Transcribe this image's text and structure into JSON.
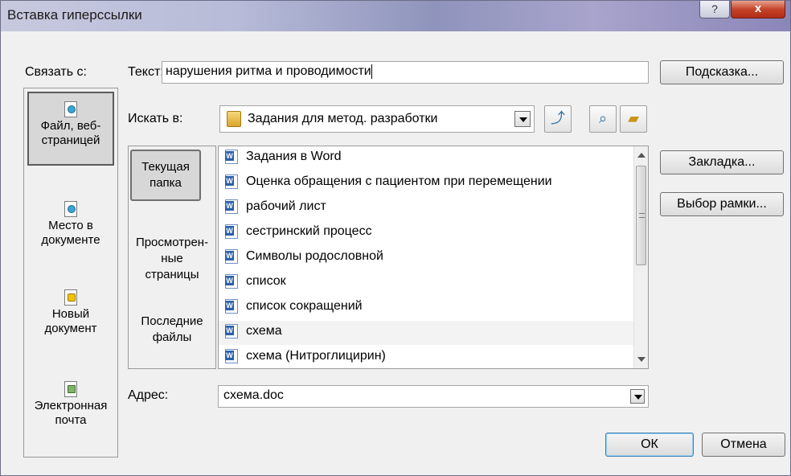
{
  "window": {
    "title": "Вставка гиперссылки",
    "help_label": "?",
    "close_label": "x"
  },
  "link_to": {
    "label": "Связать с:",
    "items": [
      {
        "line1": "Файл, веб-",
        "line2": "страницей",
        "icon": "web-page-icon",
        "selected": true
      },
      {
        "line1": "Место в",
        "line2": "документе",
        "icon": "place-in-document-icon",
        "selected": false
      },
      {
        "line1": "Новый",
        "line2": "документ",
        "icon": "new-document-icon",
        "selected": false
      },
      {
        "line1": "Электронная",
        "line2": "почта",
        "icon": "email-icon",
        "selected": false
      }
    ]
  },
  "text_field": {
    "label": "Текст:",
    "value": "нарушения ритма и проводимости"
  },
  "screentip_button": "Подсказка...",
  "look_in": {
    "label": "Искать в:",
    "value": "Задания для метод. разработки"
  },
  "look_in_panel": {
    "items": [
      {
        "line1": "Текущая",
        "line2": "папка",
        "line3": "",
        "selected": true
      },
      {
        "line1": "Просмотрен-",
        "line2": "ные",
        "line3": "страницы",
        "selected": false
      },
      {
        "line1": "Последние",
        "line2": "файлы",
        "line3": "",
        "selected": false
      }
    ]
  },
  "files": [
    "Задания в Word",
    "Оценка обращения с пациентом при перемещении",
    "рабочий лист",
    "сестринский процесс",
    "Символы родословной",
    "список",
    "список сокращений",
    "схема",
    "схема (Нитроглицирин)"
  ],
  "highlighted_file_index": 7,
  "bookmark_button": "Закладка...",
  "target_frame_button": "Выбор рамки...",
  "address": {
    "label": "Адрес:",
    "value": "схема.doc"
  },
  "ok_button": "ОК",
  "cancel_button": "Отмена",
  "icons": {
    "up-folder": "up-folder-icon",
    "browse-web": "browse-web-icon",
    "browse-file": "browse-file-icon"
  }
}
